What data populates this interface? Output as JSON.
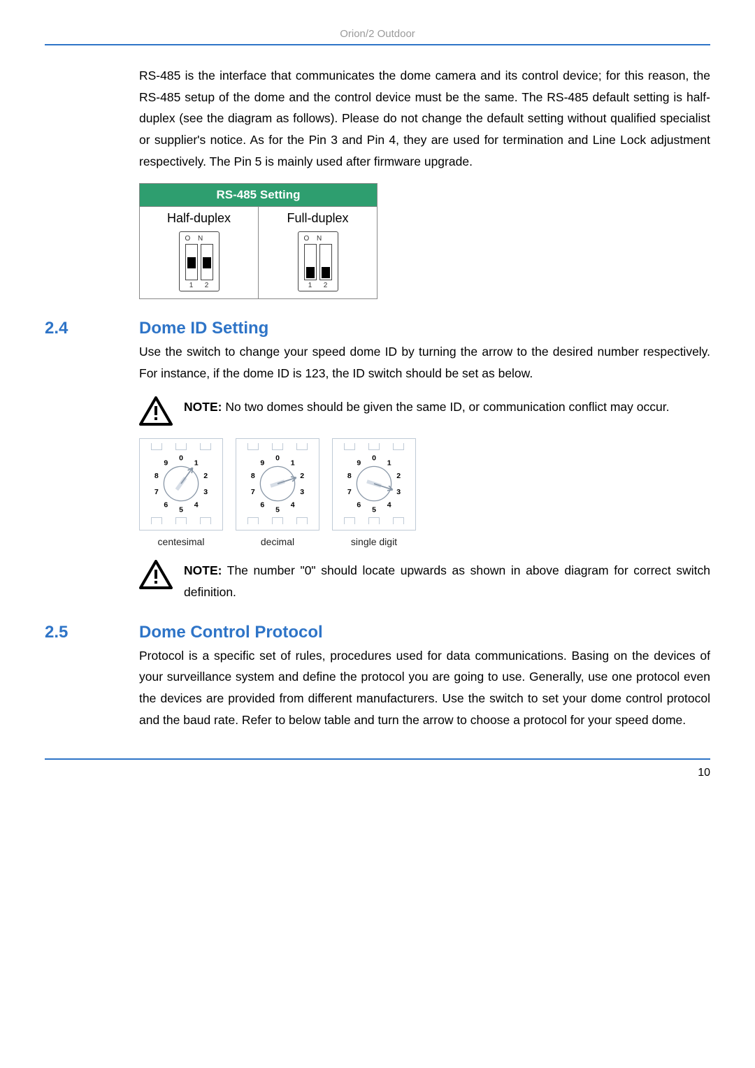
{
  "header": {
    "title": "Orion/2 Outdoor"
  },
  "intro_para": "RS-485 is the interface that communicates the dome camera and its control device; for this reason, the RS-485 setup of the dome and the control device must be the same. The RS-485 default setting is half-duplex (see the diagram as follows). Please do not change the default setting without qualified specialist or supplier's notice. As for the Pin 3 and Pin 4, they are used for termination and Line Lock adjustment respectively. The Pin 5 is mainly used after firmware upgrade.",
  "rs485_table": {
    "header": "RS-485 Setting",
    "col1_title": "Half-duplex",
    "col2_title": "Full-duplex",
    "dip_on_label": "O N",
    "dip_num_1": "1",
    "dip_num_2": "2",
    "half_positions": [
      "mid",
      "mid"
    ],
    "full_positions": [
      "bot",
      "bot"
    ]
  },
  "section_2_4": {
    "num": "2.4",
    "title": "Dome ID Setting",
    "body": "Use the switch to change your speed dome ID by turning the arrow to the desired number respectively. For instance, if the dome ID is 123, the ID switch should be set as below.",
    "note1_bold": "NOTE:",
    "note1_text": " No two domes should be given the same ID, or communication conflict may occur.",
    "rotary": {
      "digits": [
        "0",
        "1",
        "2",
        "3",
        "4",
        "5",
        "6",
        "7",
        "8",
        "9"
      ],
      "units": [
        {
          "label": "centesimal",
          "arrow_angle": 36
        },
        {
          "label": "decimal",
          "arrow_angle": 72
        },
        {
          "label": "single digit",
          "arrow_angle": 108
        }
      ]
    },
    "note2_bold": "NOTE:",
    "note2_text": " The number \"0\" should locate upwards as shown in above diagram for correct switch definition."
  },
  "section_2_5": {
    "num": "2.5",
    "title": "Dome Control Protocol",
    "body": "Protocol is a specific set of rules, procedures used for data communications. Basing on the devices of your surveillance system and define the protocol you are going to use. Generally, use one protocol even the devices are provided from different manufacturers. Use the switch to set your dome control protocol and the baud rate. Refer to below table and turn the arrow to choose a protocol for your speed dome."
  },
  "page_number": "10"
}
